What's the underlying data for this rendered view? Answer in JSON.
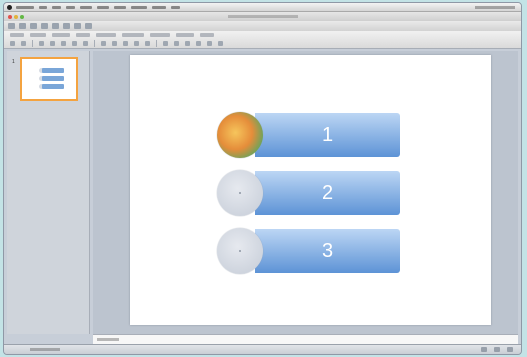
{
  "slide": {
    "rows": [
      {
        "number": "1",
        "has_photo": true
      },
      {
        "number": "2",
        "has_photo": false
      },
      {
        "number": "3",
        "has_photo": false
      }
    ]
  },
  "sidebar": {
    "slide_number": "1"
  },
  "colors": {
    "desktop": "#c3e3e6",
    "bar_top": "#bcd6f4",
    "bar_bottom": "#5d93d6",
    "thumb_selected": "#f4a340"
  }
}
